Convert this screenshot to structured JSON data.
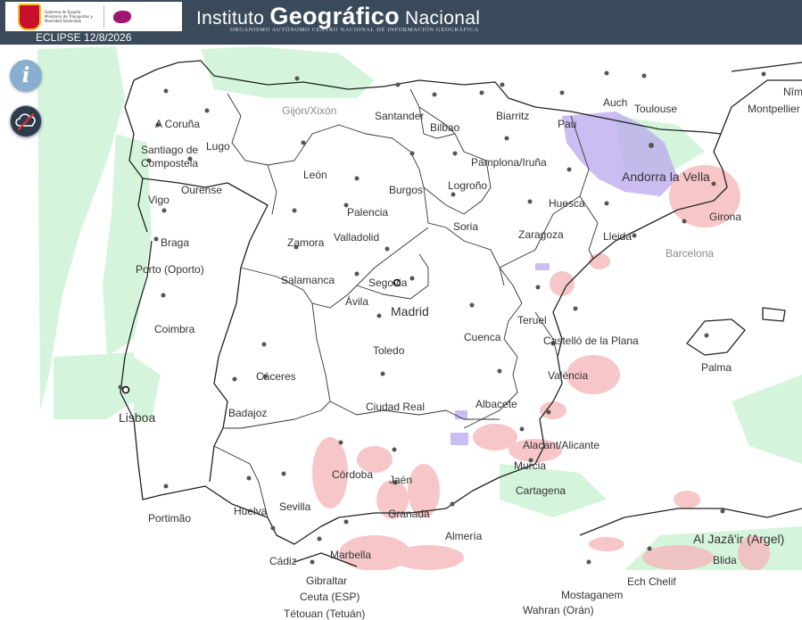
{
  "header": {
    "title_prefix": "Instituto ",
    "title_main": "Geográfico",
    "title_suffix": " Nacional",
    "subtitle": "Organismo Autónomo Centro Nacional de Información Geográfica",
    "eclipse_label": "ECLIPSE 12/8/2026",
    "gov_text": "Gobierno de España · Ministerio de Transportes y Movilidad Sostenible"
  },
  "controls": {
    "info_glyph": "i",
    "info_icon": "info-icon",
    "cloud_icon": "cloud-off-icon"
  },
  "colors": {
    "header_bg": "#3a4a5a",
    "cloud_low": "#cdf3d6",
    "cloud_mid": "#f7c6c8",
    "cloud_high": "#b9a7ee",
    "borders": "#222222"
  },
  "places": [
    {
      "name": "Gijón/Xixón"
    },
    {
      "name": "Santander"
    },
    {
      "name": "Biarritz"
    },
    {
      "name": "Auch"
    },
    {
      "name": "Toulouse"
    },
    {
      "name": "Montpellier"
    },
    {
      "name": "Nîm"
    },
    {
      "name": "A Coruña"
    },
    {
      "name": "Lugo"
    },
    {
      "name": "Bilbao"
    },
    {
      "name": "Pau"
    },
    {
      "name": "Santiago de"
    },
    {
      "name": "Compostela"
    },
    {
      "name": "León"
    },
    {
      "name": "Pamplona/Iruña"
    },
    {
      "name": "Andorra la Vella"
    },
    {
      "name": "Ourense"
    },
    {
      "name": "Burgos"
    },
    {
      "name": "Logroño"
    },
    {
      "name": "Vigo"
    },
    {
      "name": "Palencia"
    },
    {
      "name": "Huesca"
    },
    {
      "name": "Girona"
    },
    {
      "name": "Braga"
    },
    {
      "name": "Valladolid"
    },
    {
      "name": "Soria"
    },
    {
      "name": "Zaragoza"
    },
    {
      "name": "Lleida"
    },
    {
      "name": "Zamora"
    },
    {
      "name": "Barcelona"
    },
    {
      "name": "Porto (Oporto)"
    },
    {
      "name": "Salamanca"
    },
    {
      "name": "Segovia"
    },
    {
      "name": "Madrid"
    },
    {
      "name": "Ávila"
    },
    {
      "name": "Coimbra"
    },
    {
      "name": "Teruel"
    },
    {
      "name": "Cuenca"
    },
    {
      "name": "Toledo"
    },
    {
      "name": "Castelló de la Plana"
    },
    {
      "name": "Palma"
    },
    {
      "name": "Cáceres"
    },
    {
      "name": "València"
    },
    {
      "name": "Badajoz"
    },
    {
      "name": "Ciudad Real"
    },
    {
      "name": "Albacete"
    },
    {
      "name": "Lisboa"
    },
    {
      "name": "Alacant/Alicante"
    },
    {
      "name": "Murcia"
    },
    {
      "name": "Córdoba"
    },
    {
      "name": "Jaén"
    },
    {
      "name": "Cartagena"
    },
    {
      "name": "Huelva"
    },
    {
      "name": "Sevilla"
    },
    {
      "name": "Granada"
    },
    {
      "name": "Portimão"
    },
    {
      "name": "Almería"
    },
    {
      "name": "Al Jazā'ir (Argel)"
    },
    {
      "name": "Blida"
    },
    {
      "name": "Cádiz"
    },
    {
      "name": "Marbella"
    },
    {
      "name": "Gibraltar"
    },
    {
      "name": "Ech Chelif"
    },
    {
      "name": "Ceuta (ESP)"
    },
    {
      "name": "Mostaganem"
    },
    {
      "name": "Tétouan (Tetuán)"
    },
    {
      "name": "Wahran (Orán)"
    }
  ]
}
